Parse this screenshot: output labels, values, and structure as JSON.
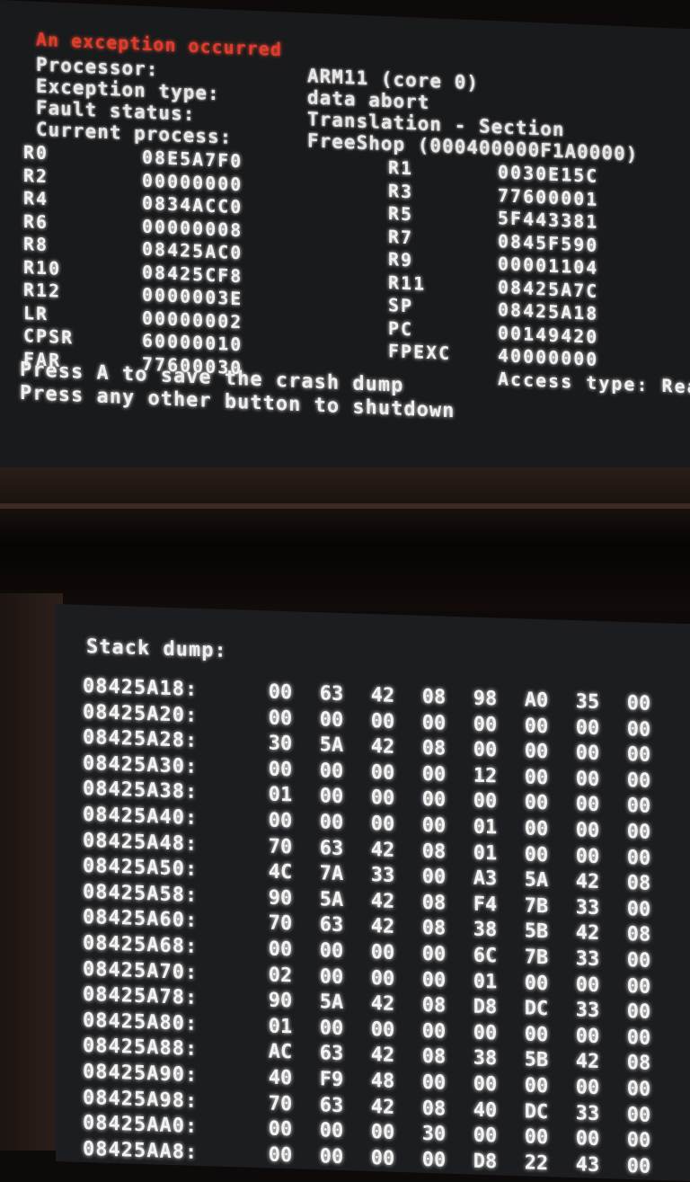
{
  "top": {
    "title": "An exception occurred",
    "info": [
      {
        "label": "Processor:",
        "value": "ARM11 (core 0)"
      },
      {
        "label": "Exception type:",
        "value": "data abort"
      },
      {
        "label": "Fault status:",
        "value": "Translation - Section"
      },
      {
        "label": "Current process:",
        "value": "FreeShop (000400000F1A0000)"
      }
    ],
    "registers_left": [
      {
        "name": "R0",
        "value": "08E5A7F0"
      },
      {
        "name": "R2",
        "value": "00000000"
      },
      {
        "name": "R4",
        "value": "0834ACC0"
      },
      {
        "name": "R6",
        "value": "00000008"
      },
      {
        "name": "R8",
        "value": "08425AC0"
      },
      {
        "name": "R10",
        "value": "08425CF8"
      },
      {
        "name": "R12",
        "value": "0000003E"
      },
      {
        "name": "LR",
        "value": "00000002"
      },
      {
        "name": "CPSR",
        "value": "60000010"
      },
      {
        "name": "FAR",
        "value": "77600030"
      }
    ],
    "registers_right": [
      {
        "name": "R1",
        "value": "0030E15C"
      },
      {
        "name": "R3",
        "value": "77600001"
      },
      {
        "name": "R5",
        "value": "5F443381"
      },
      {
        "name": "R7",
        "value": "0845F590"
      },
      {
        "name": "R9",
        "value": "00001104"
      },
      {
        "name": "R11",
        "value": "08425A7C"
      },
      {
        "name": "SP",
        "value": "08425A18"
      },
      {
        "name": "PC",
        "value": "00149420"
      },
      {
        "name": "FPEXC",
        "value": "40000000"
      },
      {
        "name": "",
        "value": "Access type: Read"
      }
    ],
    "prompt_a": "Press A to save the crash dump",
    "prompt_other": "Press any other button to shutdown"
  },
  "bottom": {
    "title": "Stack dump:",
    "rows": [
      {
        "addr": "08425A18:",
        "bytes": [
          "00",
          "63",
          "42",
          "08",
          "98",
          "A0",
          "35",
          "00"
        ]
      },
      {
        "addr": "08425A20:",
        "bytes": [
          "00",
          "00",
          "00",
          "00",
          "00",
          "00",
          "00",
          "00"
        ]
      },
      {
        "addr": "08425A28:",
        "bytes": [
          "30",
          "5A",
          "42",
          "08",
          "00",
          "00",
          "00",
          "00"
        ]
      },
      {
        "addr": "08425A30:",
        "bytes": [
          "00",
          "00",
          "00",
          "00",
          "12",
          "00",
          "00",
          "00"
        ]
      },
      {
        "addr": "08425A38:",
        "bytes": [
          "01",
          "00",
          "00",
          "00",
          "00",
          "00",
          "00",
          "00"
        ]
      },
      {
        "addr": "08425A40:",
        "bytes": [
          "00",
          "00",
          "00",
          "00",
          "01",
          "00",
          "00",
          "00"
        ]
      },
      {
        "addr": "08425A48:",
        "bytes": [
          "70",
          "63",
          "42",
          "08",
          "01",
          "00",
          "00",
          "00"
        ]
      },
      {
        "addr": "08425A50:",
        "bytes": [
          "4C",
          "7A",
          "33",
          "00",
          "A3",
          "5A",
          "42",
          "08"
        ]
      },
      {
        "addr": "08425A58:",
        "bytes": [
          "90",
          "5A",
          "42",
          "08",
          "F4",
          "7B",
          "33",
          "00"
        ]
      },
      {
        "addr": "08425A60:",
        "bytes": [
          "70",
          "63",
          "42",
          "08",
          "38",
          "5B",
          "42",
          "08"
        ]
      },
      {
        "addr": "08425A68:",
        "bytes": [
          "00",
          "00",
          "00",
          "00",
          "6C",
          "7B",
          "33",
          "00"
        ]
      },
      {
        "addr": "08425A70:",
        "bytes": [
          "02",
          "00",
          "00",
          "00",
          "01",
          "00",
          "00",
          "00"
        ]
      },
      {
        "addr": "08425A78:",
        "bytes": [
          "90",
          "5A",
          "42",
          "08",
          "D8",
          "DC",
          "33",
          "00"
        ]
      },
      {
        "addr": "08425A80:",
        "bytes": [
          "01",
          "00",
          "00",
          "00",
          "00",
          "00",
          "00",
          "00"
        ]
      },
      {
        "addr": "08425A88:",
        "bytes": [
          "AC",
          "63",
          "42",
          "08",
          "38",
          "5B",
          "42",
          "08"
        ]
      },
      {
        "addr": "08425A90:",
        "bytes": [
          "40",
          "F9",
          "48",
          "00",
          "00",
          "00",
          "00",
          "00"
        ]
      },
      {
        "addr": "08425A98:",
        "bytes": [
          "70",
          "63",
          "42",
          "08",
          "40",
          "DC",
          "33",
          "00"
        ]
      },
      {
        "addr": "08425AA0:",
        "bytes": [
          "00",
          "00",
          "00",
          "30",
          "00",
          "00",
          "00",
          "00"
        ]
      },
      {
        "addr": "08425AA8:",
        "bytes": [
          "00",
          "00",
          "00",
          "00",
          "D8",
          "22",
          "43",
          "00"
        ]
      }
    ]
  }
}
